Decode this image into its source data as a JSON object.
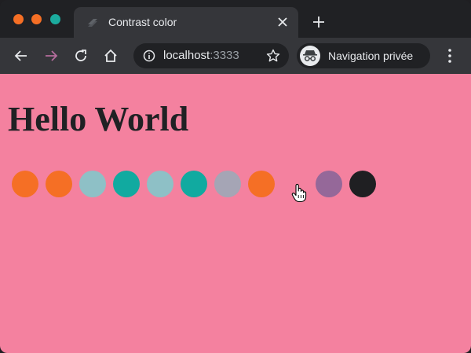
{
  "window": {
    "traffic_colors": [
      "#f56f25",
      "#f56f25",
      "#1bab9e"
    ]
  },
  "tab": {
    "title": "Contrast color",
    "favicon_icon": "layers-icon",
    "close_icon": "close-icon"
  },
  "new_tab_icon": "plus-icon",
  "toolbar": {
    "back_icon": "arrow-left-icon",
    "forward_icon": "arrow-right-icon",
    "reload_icon": "reload-icon",
    "home_icon": "home-icon",
    "url_host": "localhost",
    "url_port": ":3333",
    "bookmark_icon": "star-icon",
    "incognito_label": "Navigation privée",
    "menu_icon": "kebab-menu-icon"
  },
  "page": {
    "heading": "Hello World",
    "background": "#f4819f",
    "swatches": [
      {
        "color": "#f56f25"
      },
      {
        "color": "#f56f25"
      },
      {
        "color": "#8ec0c6"
      },
      {
        "color": "#11aaa0"
      },
      {
        "color": "#8ec0c6"
      },
      {
        "color": "#11aaa0"
      },
      {
        "color": "#a5a5b5"
      },
      {
        "color": "#f56f25"
      },
      {
        "color": "#956899"
      },
      {
        "color": "#1f1f22"
      }
    ]
  }
}
